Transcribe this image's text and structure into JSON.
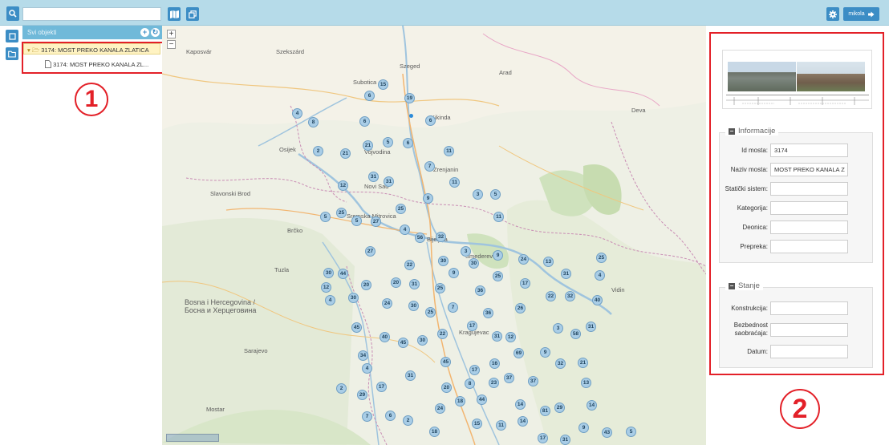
{
  "toolbar": {
    "search_placeholder": "",
    "user_label": "mikola",
    "icons": [
      "search-icon",
      "map-icon",
      "layers-icon",
      "gear-icon",
      "logout-icon"
    ]
  },
  "tree": {
    "header": "Svi objekti",
    "item_folder": "3174: MOST PREKO KANALA ZLATICA",
    "item_file": "3174: MOST PREKO KANALA ZL..."
  },
  "annotations": {
    "one": "1",
    "two": "2"
  },
  "map": {
    "labels": [
      {
        "text": "Kaposvár"
      },
      {
        "text": "Szekszárd"
      },
      {
        "text": "Szeged"
      },
      {
        "text": "Arad"
      },
      {
        "text": "Subotica"
      },
      {
        "text": "Kikinda"
      },
      {
        "text": "Osijek"
      },
      {
        "text": "Vojvodina"
      },
      {
        "text": "Zrenjanin"
      },
      {
        "text": "Novi Sad"
      },
      {
        "text": "Slavonski Brod"
      },
      {
        "text": "Sremska Mitrovica"
      },
      {
        "text": "Bijeljina"
      },
      {
        "text": "Brčko"
      },
      {
        "text": "Tuzla"
      },
      {
        "text": "Smederevo"
      },
      {
        "text": "Bosna i Hercegovina / Босна и Херцеговина"
      },
      {
        "text": "Sarajevo"
      },
      {
        "text": "Kragujevac"
      },
      {
        "text": "Deva"
      },
      {
        "text": "Vidin"
      },
      {
        "text": "Mostar"
      }
    ],
    "clusters": [
      {
        "n": "15"
      },
      {
        "n": "6"
      },
      {
        "n": "19"
      },
      {
        "n": "4"
      },
      {
        "n": "8"
      },
      {
        "n": "6"
      },
      {
        "n": "6"
      },
      {
        "n": "2"
      },
      {
        "n": "21"
      },
      {
        "n": "21"
      },
      {
        "n": "5"
      },
      {
        "n": "6"
      },
      {
        "n": "11"
      },
      {
        "n": "7"
      },
      {
        "n": "31"
      },
      {
        "n": "31"
      },
      {
        "n": "12"
      },
      {
        "n": "11"
      },
      {
        "n": "9"
      },
      {
        "n": "3"
      },
      {
        "n": "5"
      },
      {
        "n": "5"
      },
      {
        "n": "25"
      },
      {
        "n": "5"
      },
      {
        "n": "27"
      },
      {
        "n": "25"
      },
      {
        "n": "11"
      },
      {
        "n": "4"
      },
      {
        "n": "56"
      },
      {
        "n": "32"
      },
      {
        "n": "27"
      },
      {
        "n": "3"
      },
      {
        "n": "9"
      },
      {
        "n": "24"
      },
      {
        "n": "13"
      },
      {
        "n": "25"
      },
      {
        "n": "30"
      },
      {
        "n": "44"
      },
      {
        "n": "22"
      },
      {
        "n": "30"
      },
      {
        "n": "30"
      },
      {
        "n": "9"
      },
      {
        "n": "25"
      },
      {
        "n": "31"
      },
      {
        "n": "4"
      },
      {
        "n": "12"
      },
      {
        "n": "20"
      },
      {
        "n": "20"
      },
      {
        "n": "31"
      },
      {
        "n": "25"
      },
      {
        "n": "36"
      },
      {
        "n": "17"
      },
      {
        "n": "4"
      },
      {
        "n": "30"
      },
      {
        "n": "24"
      },
      {
        "n": "30"
      },
      {
        "n": "25"
      },
      {
        "n": "7"
      },
      {
        "n": "36"
      },
      {
        "n": "26"
      },
      {
        "n": "22"
      },
      {
        "n": "32"
      },
      {
        "n": "40"
      },
      {
        "n": "45"
      },
      {
        "n": "40"
      },
      {
        "n": "45"
      },
      {
        "n": "30"
      },
      {
        "n": "22"
      },
      {
        "n": "17"
      },
      {
        "n": "31"
      },
      {
        "n": "12"
      },
      {
        "n": "3"
      },
      {
        "n": "58"
      },
      {
        "n": "31"
      },
      {
        "n": "34"
      },
      {
        "n": "69"
      },
      {
        "n": "9"
      },
      {
        "n": "4"
      },
      {
        "n": "45"
      },
      {
        "n": "17"
      },
      {
        "n": "16"
      },
      {
        "n": "32"
      },
      {
        "n": "21"
      },
      {
        "n": "31"
      },
      {
        "n": "20"
      },
      {
        "n": "8"
      },
      {
        "n": "23"
      },
      {
        "n": "37"
      },
      {
        "n": "37"
      },
      {
        "n": "13"
      },
      {
        "n": "2"
      },
      {
        "n": "29"
      },
      {
        "n": "17"
      },
      {
        "n": "18"
      },
      {
        "n": "44"
      },
      {
        "n": "14"
      },
      {
        "n": "81"
      },
      {
        "n": "29"
      },
      {
        "n": "14"
      },
      {
        "n": "7"
      },
      {
        "n": "6"
      },
      {
        "n": "2"
      },
      {
        "n": "24"
      },
      {
        "n": "15"
      },
      {
        "n": "11"
      },
      {
        "n": "14"
      },
      {
        "n": "9"
      },
      {
        "n": "43"
      },
      {
        "n": "5"
      },
      {
        "n": "18"
      },
      {
        "n": "17"
      },
      {
        "n": "31"
      }
    ]
  },
  "panel": {
    "info_title": "Informacije",
    "state_title": "Stanje",
    "fields": [
      {
        "label": "Id mosta:",
        "value": "3174"
      },
      {
        "label": "Naziv mosta:",
        "value": "MOST PREKO KANALA Z"
      },
      {
        "label": "Statički sistem:",
        "value": ""
      },
      {
        "label": "Kategorija:",
        "value": ""
      },
      {
        "label": "Deonica:",
        "value": ""
      },
      {
        "label": "Prepreka:",
        "value": ""
      }
    ],
    "state_fields": [
      {
        "label": "Konstrukcija:",
        "value": ""
      },
      {
        "label": "Bezbednost saobraćaja:",
        "value": ""
      },
      {
        "label": "Datum:",
        "value": ""
      }
    ]
  }
}
